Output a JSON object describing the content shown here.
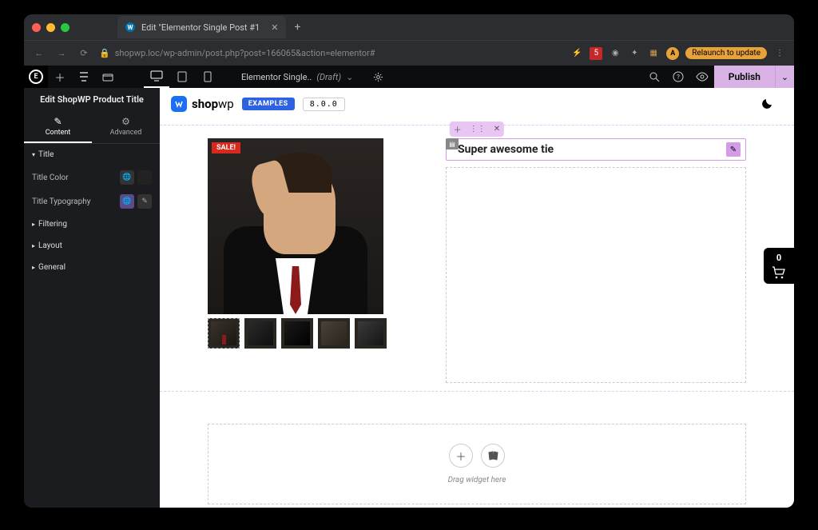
{
  "browser": {
    "tab_title": "Edit \"Elementor Single Post #1",
    "url": "shopwp.loc/wp-admin/post.php?post=166065&action=elementor#",
    "badge": "5",
    "avatar_letter": "A",
    "relaunch": "Relaunch to update"
  },
  "topbar": {
    "doc_name": "Elementor Single..",
    "doc_mode": "(Draft)",
    "publish": "Publish"
  },
  "sidebar": {
    "header": "Edit ShopWP Product Title",
    "tabs": {
      "content": "Content",
      "advanced": "Advanced"
    },
    "sections": {
      "title": "Title",
      "filtering": "Filtering",
      "layout": "Layout",
      "general": "General"
    },
    "fields": {
      "title_color": "Title Color",
      "title_typography": "Title Typography"
    }
  },
  "brand": {
    "name_a": "shop",
    "name_b": "wp",
    "badge": "EXAMPLES",
    "version": "8.0.0"
  },
  "product": {
    "sale": "SALE!",
    "title": "Super awesome tie"
  },
  "dropzone": {
    "hint": "Drag widget here"
  },
  "cart": {
    "count": "0"
  }
}
